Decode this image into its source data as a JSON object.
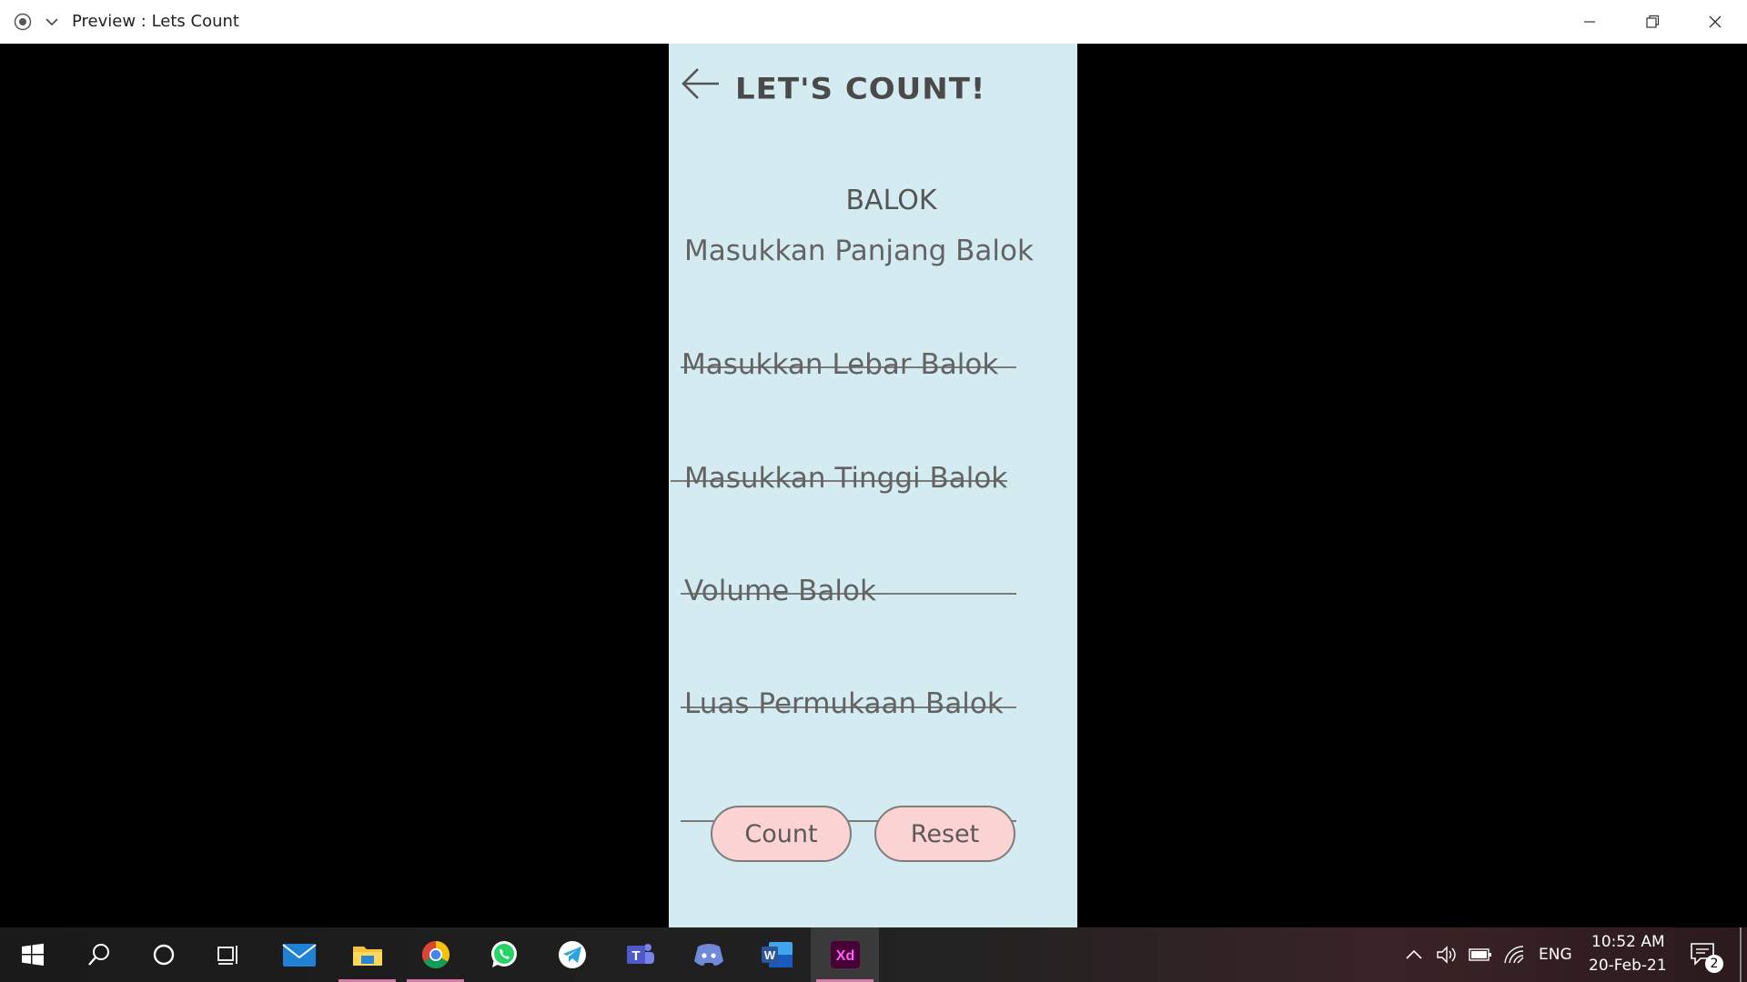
{
  "window": {
    "title": "Preview : Lets Count"
  },
  "app": {
    "title": "LET'S COUNT!",
    "section": "BALOK",
    "fields": [
      {
        "label": "Masukkan Panjang Balok"
      },
      {
        "label": "Masukkan Lebar Balok"
      },
      {
        "label": "Masukkan Tinggi Balok"
      },
      {
        "label": "Volume Balok"
      },
      {
        "label": "Luas Permukaan Balok"
      }
    ],
    "buttons": {
      "count": "Count",
      "reset": "Reset"
    }
  },
  "taskbar": {
    "apps": [
      "start-icon",
      "search-icon",
      "cortana-icon",
      "task-view-icon",
      "mail-icon",
      "file-explorer-icon",
      "chrome-icon",
      "whatsapp-icon",
      "telegram-icon",
      "teams-icon",
      "discord-icon",
      "word-icon",
      "adobe-xd-icon"
    ],
    "language": "ENG",
    "time": "10:52 AM",
    "date": "20-Feb-21",
    "notification_count": "2"
  },
  "colors": {
    "artboard_bg": "#d4ecf1",
    "button_bg": "#fcd3d3",
    "text": "#636363"
  }
}
